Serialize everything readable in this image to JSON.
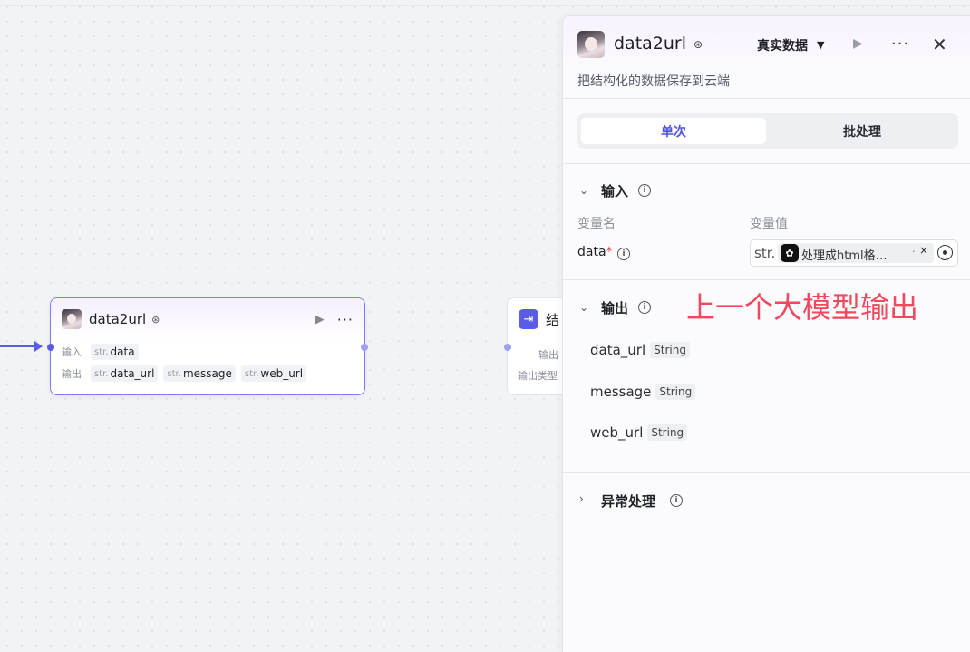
{
  "node": {
    "title": "data2url",
    "input_label": "输入",
    "output_label": "输出",
    "inputs": [
      {
        "type": "str.",
        "name": "data"
      }
    ],
    "outputs": [
      {
        "type": "str.",
        "name": "data_url"
      },
      {
        "type": "str.",
        "name": "message"
      },
      {
        "type": "str.",
        "name": "web_url"
      }
    ]
  },
  "node2": {
    "title": "结",
    "row1": "输出",
    "row2": "输出类型"
  },
  "panel": {
    "title": "data2url",
    "mode": "真实数据",
    "description": "把结构化的数据保存到云端",
    "tabs": {
      "single": "单次",
      "batch": "批处理"
    },
    "input_section": {
      "title": "输入",
      "col_name": "变量名",
      "col_value": "变量值",
      "var_name": "data",
      "required_mark": "*",
      "value_type": "str.",
      "value_ref": "处理成html格…",
      "value_dot": "·",
      "value_clear": "×"
    },
    "output_section": {
      "title": "输出",
      "items": [
        {
          "name": "data_url",
          "type": "String"
        },
        {
          "name": "message",
          "type": "String"
        },
        {
          "name": "web_url",
          "type": "String"
        }
      ]
    },
    "error_section": {
      "title": "异常处理"
    }
  },
  "annotation": "上一个大模型输出",
  "colors": {
    "accent": "#4d53e8",
    "annotation": "#f0485d",
    "node_border": "#7b7df0"
  }
}
